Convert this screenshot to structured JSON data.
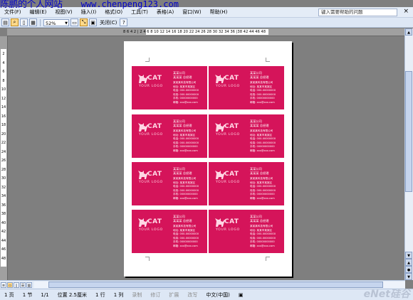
{
  "watermark": {
    "title": "陈鹏的个人网站",
    "url": "www.chenpeng123.com"
  },
  "menubar": {
    "items": [
      "文件(F)",
      "编辑(E)",
      "视图(V)",
      "插入(I)",
      "格式(O)",
      "工具(T)",
      "表格(A)",
      "窗口(W)",
      "帮助(H)"
    ],
    "help_placeholder": "键入需要帮助的问题",
    "close_icon": "close-icon"
  },
  "toolbar": {
    "zoom": "52%",
    "close_label": "关闭(C)"
  },
  "ruler": {
    "h_ticks": "8 6 4 2 | 2 4 6 8 10 12 14 16 18 20 22 24 26 28 30 32 34 36 |38 42 44 46 48",
    "v_ticks": [
      "2",
      "4",
      "6",
      "8",
      "10",
      "12",
      "14",
      "16",
      "18",
      "20",
      "22",
      "24",
      "26",
      "28",
      "30",
      "32",
      "34",
      "36",
      "38",
      "40",
      "42",
      "44",
      "46",
      "48"
    ]
  },
  "card": {
    "logo_text": "CAT",
    "logo_sub": "YOUR LOGO",
    "info": [
      "某某公司",
      "某某某 总经理",
      "",
      "某某某科技有限公司",
      "地址: 某某市某某区",
      "电话: 000-00000000",
      "传真: 000-00000000",
      "手机: 00000000000",
      "邮箱: xxx@xxx.com"
    ],
    "color": "#d5145a"
  },
  "statusbar": {
    "page": "1 页",
    "section": "1 节",
    "page_of": "1/1",
    "position": "位置 2.5厘米",
    "line": "1 行",
    "column": "1 列",
    "rec": "录制",
    "trk": "修订",
    "ext": "扩展",
    "ovr": "改写",
    "language": "中文(中国)",
    "brand": "eNet硅谷"
  }
}
